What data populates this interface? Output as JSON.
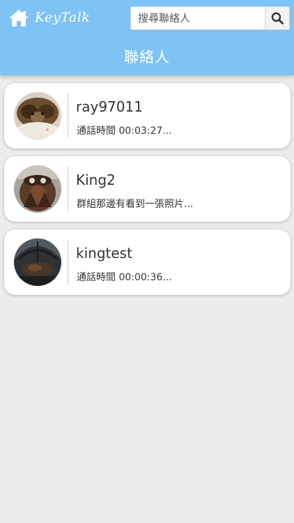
{
  "header": {
    "brand": "KeyTalk",
    "search_placeholder": "搜尋聯絡人",
    "title": "聯絡人",
    "home_icon": "home-icon",
    "search_icon": "magnifier-icon",
    "accent_color": "#7ec3f3"
  },
  "contacts": [
    {
      "name": "ray97011",
      "last_message": "通話時間 00:03:27..."
    },
    {
      "name": "King2",
      "last_message": "群組那邊有看到一張照片..."
    },
    {
      "name": "kingtest",
      "last_message": "通話時間 00:00:36..."
    }
  ]
}
